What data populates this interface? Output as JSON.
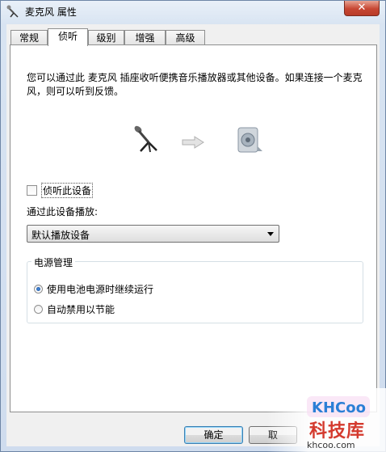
{
  "window": {
    "title": "麦克风 属性",
    "close_glyph": "✕"
  },
  "tabs": [
    {
      "label": "常规",
      "active": false
    },
    {
      "label": "侦听",
      "active": true
    },
    {
      "label": "级别",
      "active": false
    },
    {
      "label": "增强",
      "active": false
    },
    {
      "label": "高级",
      "active": false
    }
  ],
  "panel": {
    "description": "您可以通过此 麦克风 插座收听便携音乐播放器或其他设备。如果连接一个麦克风，则可以听到反馈。",
    "listen_checkbox": {
      "label": "侦听此设备",
      "checked": false
    },
    "playback_label": "通过此设备播放:",
    "playback_device": "默认播放设备",
    "power": {
      "title": "电源管理",
      "options": [
        {
          "label": "使用电池电源时继续运行",
          "selected": true
        },
        {
          "label": "自动禁用以节能",
          "selected": false
        }
      ]
    }
  },
  "buttons": {
    "ok": "确定",
    "cancel": "取"
  },
  "watermark": {
    "logo": "KHCoo",
    "name": "科技库",
    "url": "khcoo.com"
  }
}
